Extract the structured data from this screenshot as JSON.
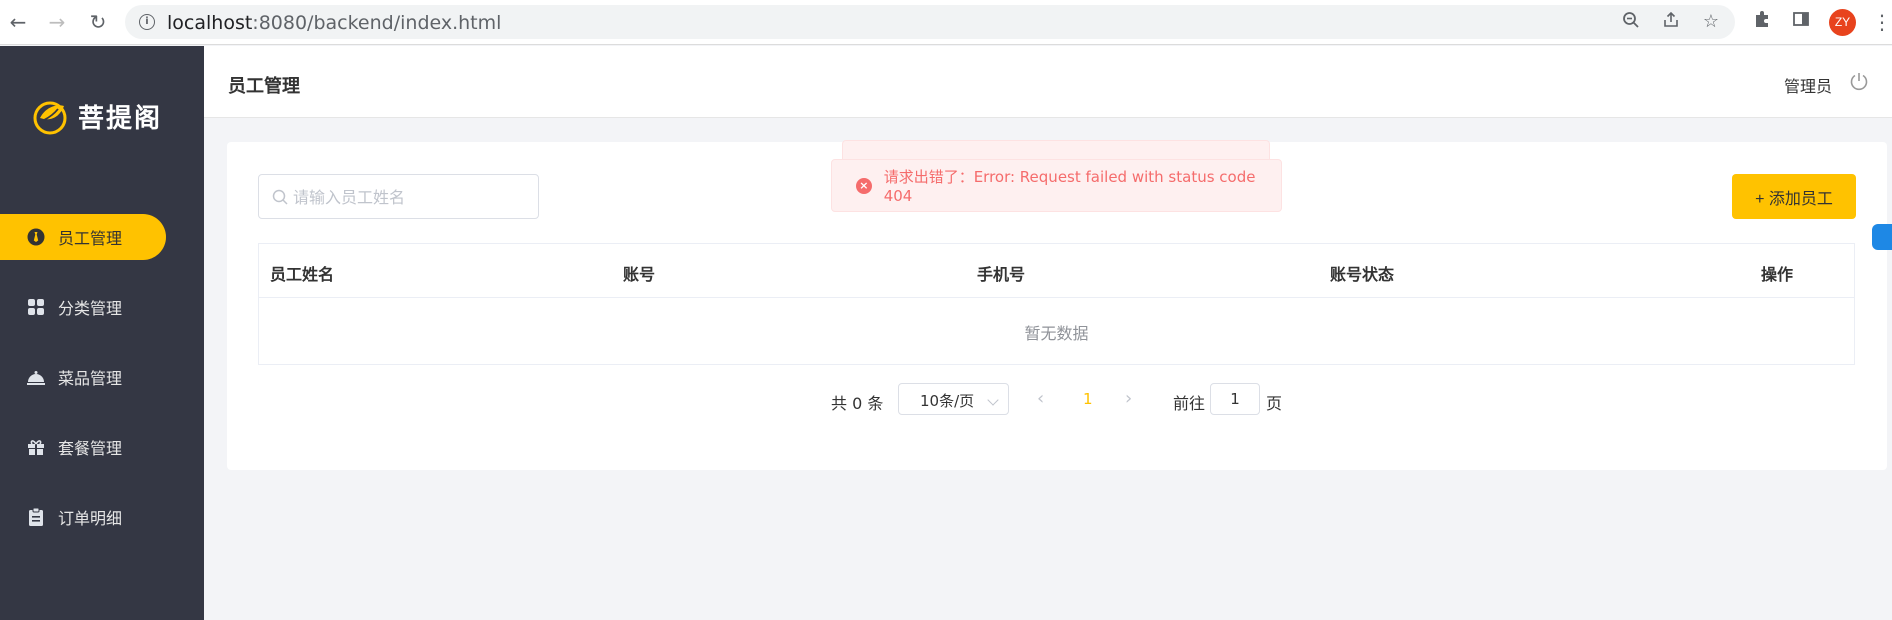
{
  "browser": {
    "url_host": "localhost",
    "url_rest": ":8080/backend/index.html",
    "profile_initials": "ZY"
  },
  "sidebar": {
    "logo_text": "菩提阁",
    "items": [
      {
        "label": "员工管理",
        "icon": "user-tie-icon",
        "active": true
      },
      {
        "label": "分类管理",
        "icon": "grid-icon",
        "active": false
      },
      {
        "label": "菜品管理",
        "icon": "dish-cloche-icon",
        "active": false
      },
      {
        "label": "套餐管理",
        "icon": "gift-icon",
        "active": false
      },
      {
        "label": "订单明细",
        "icon": "clipboard-icon",
        "active": false
      }
    ]
  },
  "header": {
    "title": "员工管理",
    "user": "管理员"
  },
  "toolbar": {
    "search_placeholder": "请输入员工姓名",
    "add_button": "+ 添加员工"
  },
  "table": {
    "columns": [
      "员工姓名",
      "账号",
      "手机号",
      "账号状态",
      "操作"
    ],
    "rows": [],
    "empty_text": "暂无数据"
  },
  "pagination": {
    "total_text": "共 0 条",
    "page_size": "10条/页",
    "current_page": "1",
    "goto_label": "前往",
    "goto_value": "1",
    "page_suffix": "页"
  },
  "toast": {
    "type": "error",
    "message": "请求出错了：Error: Request failed with status code 404"
  },
  "colors": {
    "accent": "#ffc200",
    "sidebar_bg": "#343744",
    "error": "#f56c6c"
  }
}
